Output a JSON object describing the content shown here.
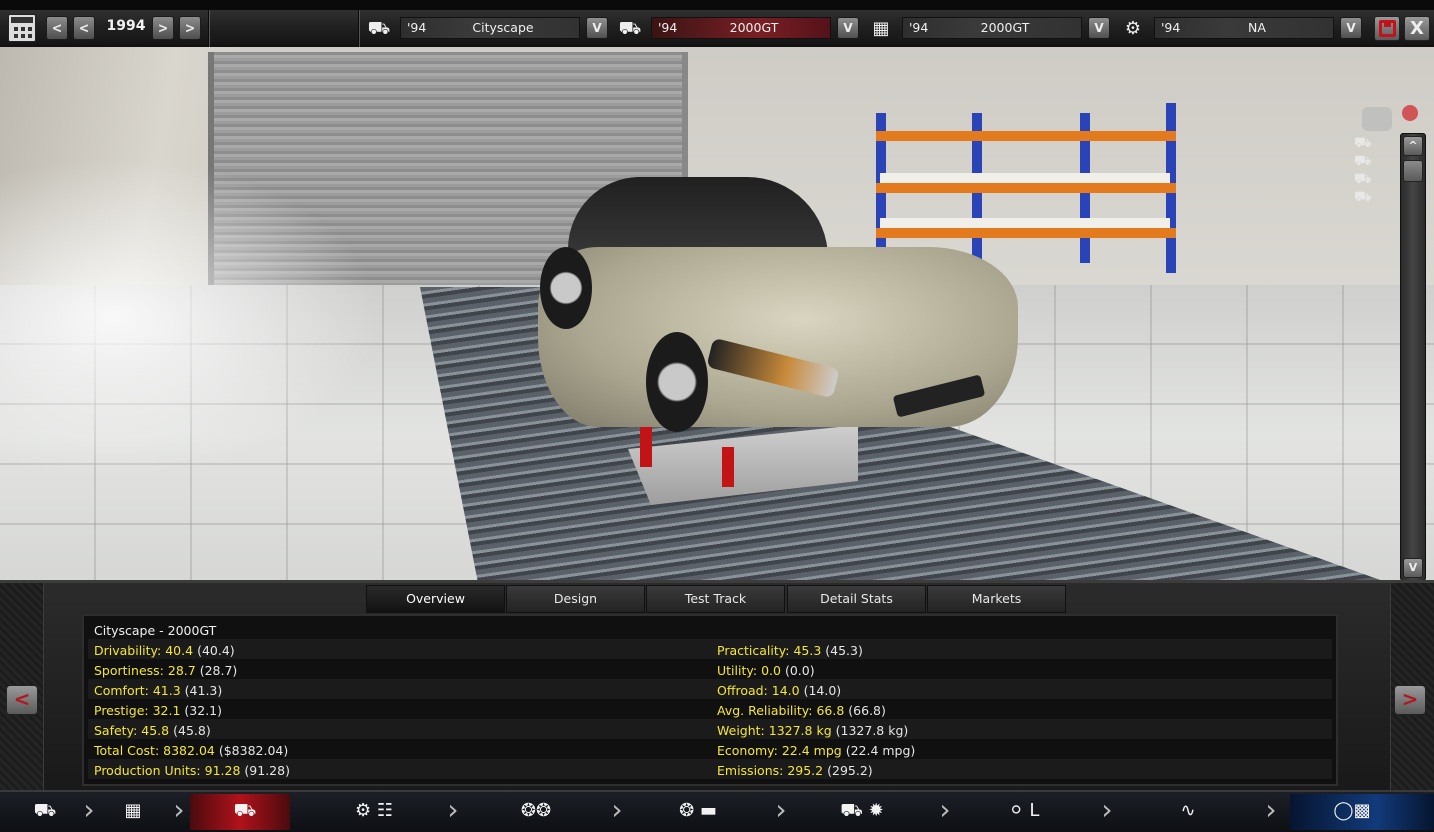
{
  "topbar": {
    "prev_fast_label": "<",
    "prev_label": "<",
    "year": "1994",
    "next_label": ">",
    "next_fast_label": ">",
    "slots": [
      {
        "year": "'94",
        "name": "Cityscape",
        "icon": "car-model-icon",
        "highlight": false
      },
      {
        "year": "'94",
        "name": "2000GT",
        "icon": "car-body-icon",
        "highlight": true
      },
      {
        "year": "'94",
        "name": "2000GT",
        "icon": "chassis-icon",
        "highlight": false
      },
      {
        "year": "'94",
        "name": "NA",
        "icon": "engine-icon",
        "highlight": false
      }
    ],
    "dropdown_label": "V",
    "close_label": "X"
  },
  "viewport": {
    "scroll_up_label": "^",
    "scroll_down_label": "V"
  },
  "tabs": [
    {
      "label": "Overview",
      "active": true
    },
    {
      "label": "Design",
      "active": false
    },
    {
      "label": "Test Track",
      "active": false
    },
    {
      "label": "Detail Stats",
      "active": false
    },
    {
      "label": "Markets",
      "active": false
    }
  ],
  "overview": {
    "title": "Cityscape - 2000GT",
    "left_stats": [
      {
        "label": "Drivability:",
        "value": "40.4",
        "paren": "(40.4)"
      },
      {
        "label": "Sportiness:",
        "value": "28.7",
        "paren": "(28.7)"
      },
      {
        "label": "Comfort:",
        "value": "41.3",
        "paren": "(41.3)"
      },
      {
        "label": "Prestige:",
        "value": "32.1",
        "paren": "(32.1)"
      },
      {
        "label": "Safety:",
        "value": "45.8",
        "paren": "(45.8)"
      },
      {
        "label": "Total Cost:",
        "value": "8382.04",
        "paren": "($8382.04)"
      },
      {
        "label": "Production Units:",
        "value": "91.28",
        "paren": "(91.28)"
      }
    ],
    "right_stats": [
      {
        "label": "Practicality:",
        "value": "45.3",
        "paren": "(45.3)"
      },
      {
        "label": "Utility:",
        "value": "0.0",
        "paren": "(0.0)"
      },
      {
        "label": "Offroad:",
        "value": "14.0",
        "paren": "(14.0)"
      },
      {
        "label": "Avg. Reliability:",
        "value": "66.8",
        "paren": "(66.8)"
      },
      {
        "label": "Weight:",
        "value": "1327.8 kg",
        "paren": "(1327.8 kg)"
      },
      {
        "label": "Economy:",
        "value": "22.4 mpg",
        "paren": "(22.4 mpg)"
      },
      {
        "label": "Emissions:",
        "value": "295.2",
        "paren": "(295.2)"
      }
    ],
    "prev_label": "<",
    "next_label": ">"
  },
  "nav": {
    "steps": [
      {
        "icon": "car-model-icon",
        "state": "normal"
      },
      {
        "icon": "chassis-icon",
        "state": "normal"
      },
      {
        "icon": "car-body-icon",
        "state": "current"
      },
      {
        "icon": "engine-gearbox-icon",
        "state": "normal"
      },
      {
        "icon": "wheels-icon",
        "state": "normal"
      },
      {
        "icon": "tire-brakes-icon",
        "state": "normal"
      },
      {
        "icon": "aero-cooling-icon",
        "state": "normal"
      },
      {
        "icon": "interior-icon",
        "state": "normal"
      },
      {
        "icon": "suspension-icon",
        "state": "normal"
      },
      {
        "icon": "finish-flag-icon",
        "state": "final"
      }
    ]
  },
  "colors": {
    "accent_yellow": "#f5e63a",
    "selected_red": "#b0121b",
    "final_blue": "#123a7a"
  }
}
